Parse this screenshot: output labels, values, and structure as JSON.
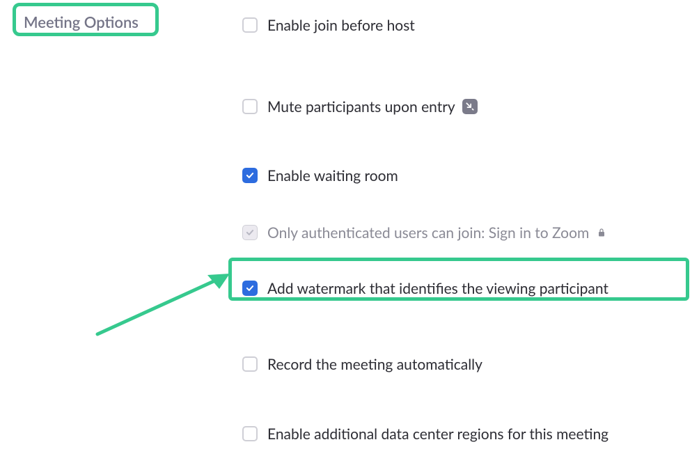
{
  "section": {
    "heading": "Meeting Options"
  },
  "options": [
    {
      "label": "Enable join before host",
      "state": "unchecked"
    },
    {
      "label": "Mute participants upon entry",
      "state": "unchecked",
      "info": true
    },
    {
      "label": "Enable waiting room",
      "state": "checked"
    },
    {
      "label": "Only authenticated users can join: Sign in to Zoom",
      "state": "disabled-checked",
      "locked": true
    },
    {
      "label": "Add watermark that identifies the viewing participant",
      "state": "checked"
    },
    {
      "label": "Record the meeting automatically",
      "state": "unchecked"
    },
    {
      "label": "Enable additional data center regions for this meeting",
      "state": "unchecked"
    }
  ],
  "row_tops": [
    10,
    127,
    226,
    308,
    388,
    497,
    597
  ],
  "icons": {
    "check": "✓",
    "info": "⦧",
    "lock": "🔒"
  },
  "colors": {
    "highlight": "#36c98e",
    "checked_bg": "#2d6cdf"
  }
}
